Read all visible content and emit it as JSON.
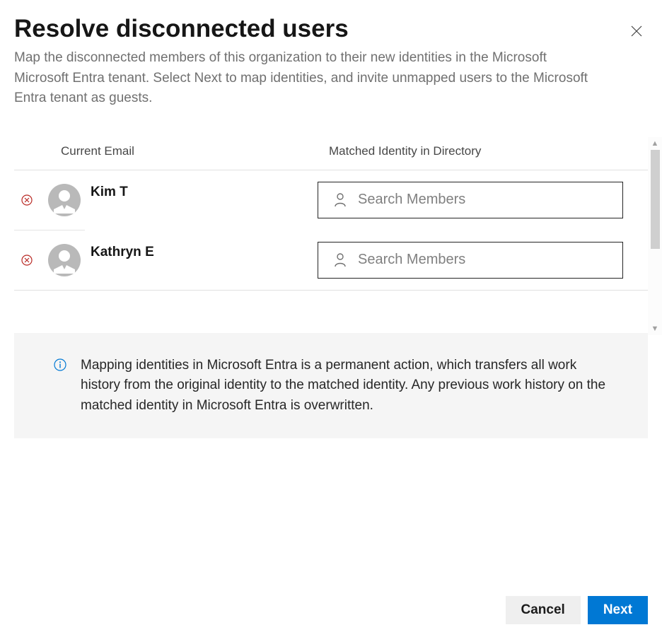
{
  "header": {
    "title": "Resolve disconnected users",
    "description": "Map the disconnected members of this organization to their new identities in the Microsoft Microsoft Entra tenant. Select Next to map identities, and invite unmapped users to the Microsoft Entra tenant as guests."
  },
  "columns": {
    "email": "Current Email",
    "matched": "Matched Identity in Directory"
  },
  "search_placeholder": "Search Members",
  "users": [
    {
      "name": "Kim T"
    },
    {
      "name": "Kathryn E"
    }
  ],
  "info": {
    "text": "Mapping identities in Microsoft Entra is a permanent action, which transfers all work history from the original identity to the matched identity. Any previous work history on the matched identity in Microsoft Entra is overwritten."
  },
  "footer": {
    "cancel": "Cancel",
    "next": "Next"
  }
}
